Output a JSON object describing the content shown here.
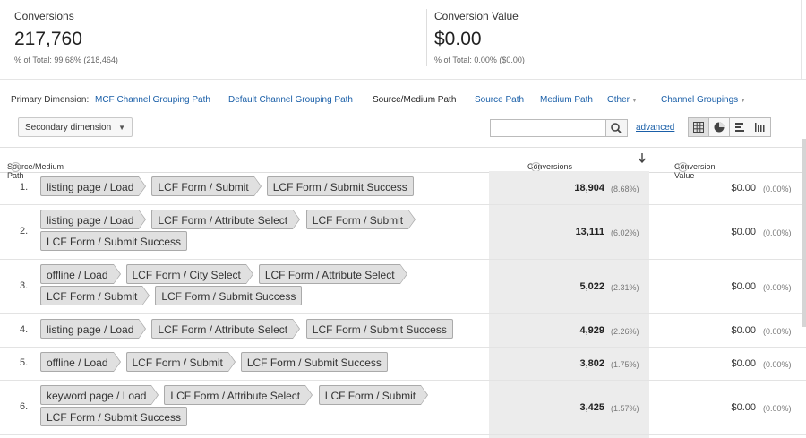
{
  "scorecards": [
    {
      "label": "Conversions",
      "value": "217,760",
      "sub": "% of Total: 99.68% (218,464)"
    },
    {
      "label": "Conversion Value",
      "value": "$0.00",
      "sub": "% of Total: 0.00% ($0.00)"
    }
  ],
  "dimensions": {
    "label": "Primary Dimension:",
    "items": [
      "MCF Channel Grouping Path",
      "Default Channel Grouping Path",
      "Source/Medium Path",
      "Source Path",
      "Medium Path",
      "Other"
    ],
    "active": "Source/Medium Path",
    "channel_groupings": "Channel Groupings"
  },
  "toolbar": {
    "secondary_dimension": "Secondary dimension",
    "search_value": "",
    "advanced": "advanced"
  },
  "table": {
    "headers": {
      "path": "Source/Medium Path",
      "conversions": "Conversions",
      "conversion_value": "Conversion Value"
    },
    "sort_icon": "arrow-down-icon",
    "rows": [
      {
        "n": "1.",
        "lines": [
          [
            "listing page / Load",
            "LCF Form / Submit",
            "LCF Form / Submit Success"
          ]
        ],
        "conv": "18,904",
        "conv_pct": "(8.68%)",
        "val": "$0.00",
        "val_pct": "(0.00%)"
      },
      {
        "n": "2.",
        "lines": [
          [
            "listing page / Load",
            "LCF Form / Attribute Select",
            "LCF Form / Submit"
          ],
          [
            "LCF Form / Submit Success"
          ]
        ],
        "conv": "13,111",
        "conv_pct": "(6.02%)",
        "val": "$0.00",
        "val_pct": "(0.00%)"
      },
      {
        "n": "3.",
        "lines": [
          [
            "offline / Load",
            "LCF Form / City Select",
            "LCF Form / Attribute Select"
          ],
          [
            "LCF Form / Submit",
            "LCF Form / Submit Success"
          ]
        ],
        "conv": "5,022",
        "conv_pct": "(2.31%)",
        "val": "$0.00",
        "val_pct": "(0.00%)"
      },
      {
        "n": "4.",
        "lines": [
          [
            "listing page / Load",
            "LCF Form / Attribute Select",
            "LCF Form / Submit Success"
          ]
        ],
        "conv": "4,929",
        "conv_pct": "(2.26%)",
        "val": "$0.00",
        "val_pct": "(0.00%)"
      },
      {
        "n": "5.",
        "lines": [
          [
            "offline / Load",
            "LCF Form / Submit",
            "LCF Form / Submit Success"
          ]
        ],
        "conv": "3,802",
        "conv_pct": "(1.75%)",
        "val": "$0.00",
        "val_pct": "(0.00%)"
      },
      {
        "n": "6.",
        "lines": [
          [
            "keyword page / Load",
            "LCF Form / Attribute Select",
            "LCF Form / Submit"
          ],
          [
            "LCF Form / Submit Success"
          ]
        ],
        "conv": "3,425",
        "conv_pct": "(1.57%)",
        "val": "$0.00",
        "val_pct": "(0.00%)"
      }
    ]
  }
}
